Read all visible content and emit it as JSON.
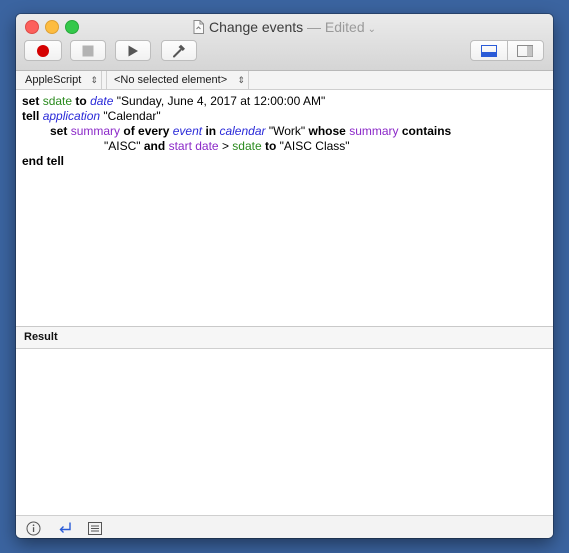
{
  "window": {
    "title": "Change events",
    "edited_label": "— Edited",
    "colors": {
      "accent": "#2a5bd7",
      "record": "#d40000"
    }
  },
  "toolbar": {
    "buttons": [
      {
        "name": "record",
        "icon": "record-icon"
      },
      {
        "name": "stop",
        "icon": "stop-icon"
      },
      {
        "name": "run",
        "icon": "play-icon"
      },
      {
        "name": "compile",
        "icon": "hammer-icon"
      }
    ],
    "view_toggles": [
      {
        "name": "show-log",
        "icon": "bottom-panel-icon",
        "selected": true
      },
      {
        "name": "show-library",
        "icon": "side-panel-icon",
        "selected": false
      }
    ]
  },
  "navbar": {
    "language": "AppleScript",
    "element": "<No selected element>"
  },
  "script": {
    "line1": {
      "set": "set",
      "sdate": "sdate",
      "to": "to",
      "date": "date",
      "str": "\"Sunday, June 4, 2017 at 12:00:00 AM\""
    },
    "line2": {
      "tell": "tell",
      "application": "application",
      "str": "\"Calendar\""
    },
    "line3": {
      "set": "set",
      "summary": "summary",
      "of_every": "of every",
      "event": "event",
      "in": "in",
      "calendar": "calendar",
      "str": "\"Work\"",
      "whose": "whose",
      "summary2": "summary",
      "contains": "contains"
    },
    "line4": {
      "str": "\"AISC\"",
      "and": "and",
      "start_date": "start date",
      "gt": ">",
      "sdate": "sdate",
      "to": "to",
      "str2": "\"AISC Class\""
    },
    "line5": {
      "end_tell": "end tell"
    }
  },
  "result": {
    "title": "Result",
    "content": ""
  },
  "bottombar": {
    "icons": [
      "info-icon",
      "reply-icon",
      "list-icon"
    ]
  }
}
